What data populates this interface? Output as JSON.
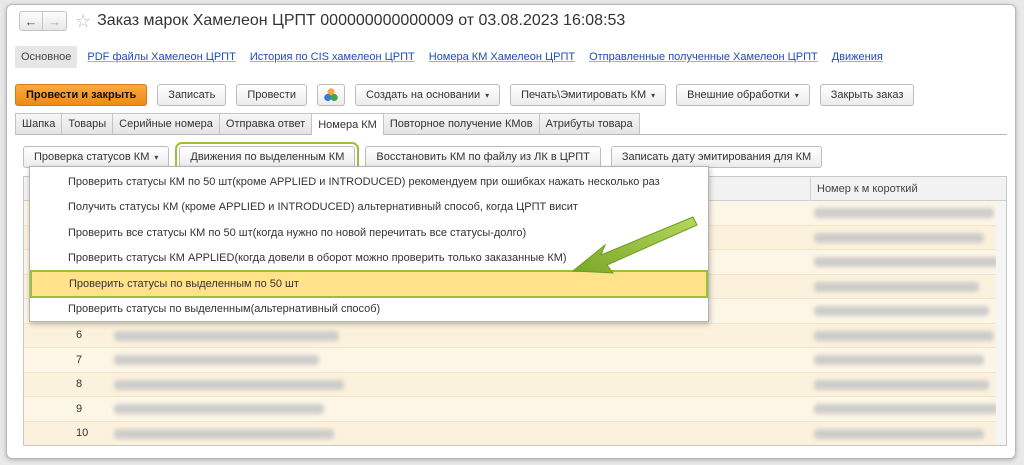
{
  "window": {
    "title": "Заказ марок Хамелеон ЦРПТ 000000000000009 от 03.08.2023 16:08:53",
    "back_glyph": "←",
    "forward_glyph": "→",
    "star_glyph": "☆"
  },
  "link_tabs": {
    "main": "Основное",
    "links": [
      "PDF файлы  Хамелеон ЦРПТ",
      "История по CIS хамелеон ЦРПТ",
      "Номера КМ Хамелеон ЦРПТ",
      "Отправленные полученные Хамелеон ЦРПТ",
      "Движения"
    ]
  },
  "toolbar": {
    "post_close": "Провести и закрыть",
    "save": "Записать",
    "post": "Провести",
    "create_based": "Создать на основании",
    "print_emit": "Печать\\Эмитировать КМ",
    "ext_processing": "Внешние обработки",
    "close_order": "Закрыть заказ",
    "caret": "▾"
  },
  "tabs": [
    "Шапка",
    "Товары",
    "Серийные номера",
    "Отправка ответ",
    "Номера КМ",
    "Повторное получение КМов",
    "Атрибуты товара"
  ],
  "active_tab": "Номера КМ",
  "subbar": {
    "check_status": "Проверка статусов КМ",
    "movements_selected": "Движения по выделенным КМ",
    "restore_from_file": "Восстановить КМ по файлу из ЛК в ЦРПТ",
    "write_emit_date": "Записать дату эмитирования для КМ"
  },
  "dropdown": {
    "items": [
      "Проверить статусы КМ по 50 шт(кроме APPLIED и INTRODUCED) рекомендуем при ошибках нажать несколько раз",
      "Получить статусы КМ (кроме APPLIED и INTRODUCED) альтернативный способ, когда ЦРПТ висит",
      "Проверить все статусы КМ по 50 шт(когда нужно по новой перечитать все статусы-долго)",
      "Проверить статусы КМ APPLIED(когда довели в оборот можно проверить только заказанные КМ)",
      "Проверить статусы по выделенным по 50 шт",
      "Проверить статусы по выделенным(альтернативный способ)"
    ],
    "selected_index": 4
  },
  "table": {
    "column_short": "Номер к м короткий",
    "row_numbers": [
      "",
      "",
      "",
      "",
      "",
      "6",
      "7",
      "8",
      "9",
      "10"
    ]
  },
  "colors": {
    "primary_button": "#ef8a14",
    "highlight_outline": "#9ac03a",
    "selected_item": "#ffe28a",
    "link": "#1a4fb5"
  }
}
